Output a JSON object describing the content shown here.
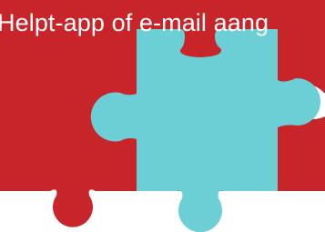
{
  "caption": {
    "text": "Helpt-app of e-mail aang"
  },
  "colors": {
    "background": "#ffffff",
    "red_piece": "#c8252b",
    "cyan_piece": "#6dcfd6",
    "text": "#ffffff"
  },
  "icons": {
    "red_piece": "puzzle-piece-red",
    "cyan_piece": "puzzle-piece-cyan"
  }
}
